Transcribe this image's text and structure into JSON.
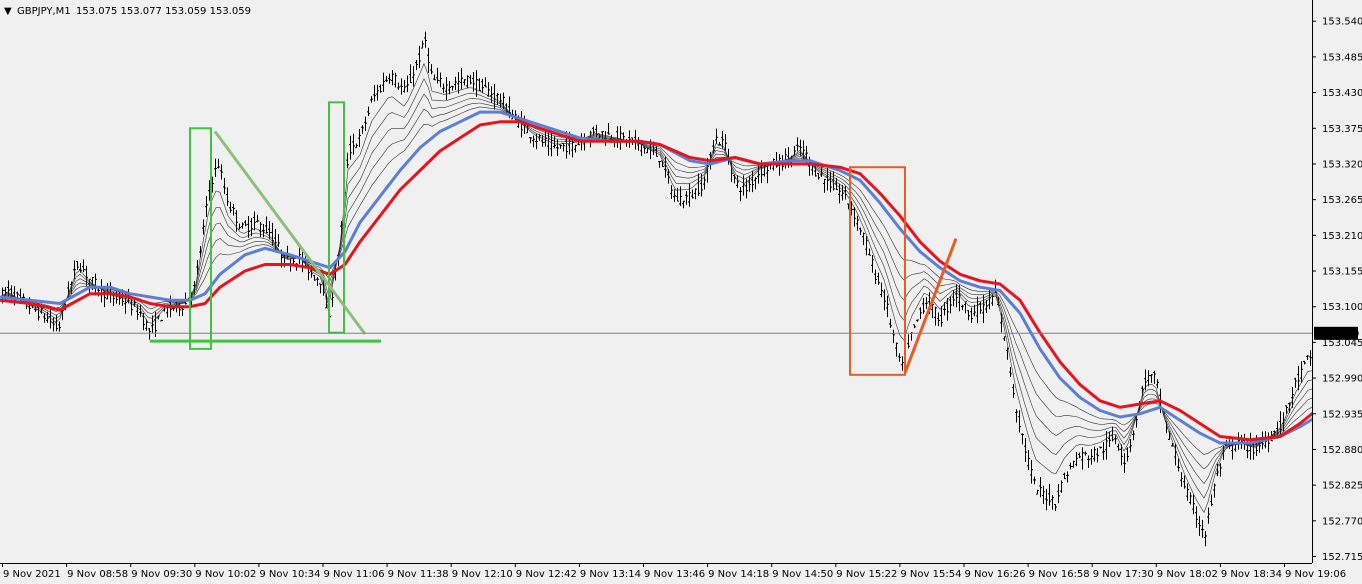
{
  "header": {
    "caret": "▼",
    "symbol": "GBPJPY,M1",
    "ohlc": "153.075 153.077 153.059 153.059"
  },
  "colors": {
    "background": "#f0f0f0",
    "candles": "#000000",
    "ema_fast": "#5b7fd6",
    "ema_slow": "#e8141c",
    "ribbon": "#303030",
    "bid_line": "#7f7f8f",
    "price_tag_bg": "#000000",
    "box_green": "#3ec43e",
    "box_orange": "#ee5a24",
    "trend_green": "#8cbf7a"
  },
  "chart_data": {
    "type": "candlestick",
    "symbol": "GBPJPY",
    "timeframe": "M1",
    "ylim": [
      152.705,
      153.565
    ],
    "current_price": 153.059,
    "current_price_label": "153.059",
    "y_ticks": [
      "153.540",
      "153.485",
      "153.430",
      "153.375",
      "153.320",
      "153.265",
      "153.210",
      "153.155",
      "153.100",
      "153.045",
      "152.990",
      "152.935",
      "152.880",
      "152.825",
      "152.770",
      "152.715"
    ],
    "x_ticks": [
      "9 Nov 2021",
      "9 Nov 08:58",
      "9 Nov 09:30",
      "9 Nov 10:02",
      "9 Nov 10:34",
      "9 Nov 11:06",
      "9 Nov 11:38",
      "9 Nov 12:10",
      "9 Nov 12:42",
      "9 Nov 13:14",
      "9 Nov 13:46",
      "9 Nov 14:18",
      "9 Nov 14:50",
      "9 Nov 15:22",
      "9 Nov 15:54",
      "9 Nov 16:26",
      "9 Nov 16:58",
      "9 Nov 17:30",
      "9 Nov 18:02",
      "9 Nov 18:34",
      "9 Nov 19:06"
    ],
    "candle_path": [
      [
        0,
        153.115
      ],
      [
        8,
        153.125
      ],
      [
        20,
        153.11
      ],
      [
        30,
        153.1
      ],
      [
        45,
        153.085
      ],
      [
        58,
        153.065
      ],
      [
        68,
        153.12
      ],
      [
        78,
        153.17
      ],
      [
        90,
        153.14
      ],
      [
        110,
        153.115
      ],
      [
        125,
        153.11
      ],
      [
        140,
        153.09
      ],
      [
        150,
        153.06
      ],
      [
        165,
        153.095
      ],
      [
        185,
        153.105
      ],
      [
        195,
        153.13
      ],
      [
        202,
        153.21
      ],
      [
        210,
        153.29
      ],
      [
        218,
        153.32
      ],
      [
        228,
        153.26
      ],
      [
        242,
        153.22
      ],
      [
        255,
        153.23
      ],
      [
        270,
        153.215
      ],
      [
        285,
        153.17
      ],
      [
        300,
        153.175
      ],
      [
        312,
        153.15
      ],
      [
        322,
        153.14
      ],
      [
        328,
        153.08
      ],
      [
        332,
        153.12
      ],
      [
        340,
        153.2
      ],
      [
        348,
        153.34
      ],
      [
        360,
        153.36
      ],
      [
        372,
        153.42
      ],
      [
        390,
        153.46
      ],
      [
        405,
        153.43
      ],
      [
        418,
        153.48
      ],
      [
        425,
        153.51
      ],
      [
        432,
        153.45
      ],
      [
        445,
        153.44
      ],
      [
        458,
        153.445
      ],
      [
        470,
        153.45
      ],
      [
        480,
        153.44
      ],
      [
        490,
        153.43
      ],
      [
        500,
        153.42
      ],
      [
        515,
        153.39
      ],
      [
        535,
        153.36
      ],
      [
        555,
        153.345
      ],
      [
        575,
        153.35
      ],
      [
        595,
        153.37
      ],
      [
        620,
        153.36
      ],
      [
        640,
        153.35
      ],
      [
        660,
        153.33
      ],
      [
        675,
        153.265
      ],
      [
        690,
        153.27
      ],
      [
        705,
        153.295
      ],
      [
        715,
        153.36
      ],
      [
        725,
        153.35
      ],
      [
        735,
        153.29
      ],
      [
        745,
        153.28
      ],
      [
        760,
        153.31
      ],
      [
        775,
        153.32
      ],
      [
        790,
        153.33
      ],
      [
        800,
        153.345
      ],
      [
        815,
        153.31
      ],
      [
        830,
        153.29
      ],
      [
        845,
        153.27
      ],
      [
        855,
        153.24
      ],
      [
        865,
        153.2
      ],
      [
        875,
        153.15
      ],
      [
        885,
        153.11
      ],
      [
        895,
        153.04
      ],
      [
        903,
        153.0
      ],
      [
        910,
        153.05
      ],
      [
        925,
        153.11
      ],
      [
        940,
        153.08
      ],
      [
        955,
        153.12
      ],
      [
        970,
        153.09
      ],
      [
        985,
        153.1
      ],
      [
        995,
        153.12
      ],
      [
        1005,
        153.05
      ],
      [
        1015,
        152.95
      ],
      [
        1025,
        152.88
      ],
      [
        1035,
        152.82
      ],
      [
        1045,
        152.81
      ],
      [
        1055,
        152.8
      ],
      [
        1065,
        152.84
      ],
      [
        1078,
        152.87
      ],
      [
        1090,
        152.87
      ],
      [
        1102,
        152.88
      ],
      [
        1115,
        152.9
      ],
      [
        1125,
        152.86
      ],
      [
        1135,
        152.92
      ],
      [
        1145,
        152.99
      ],
      [
        1155,
        152.99
      ],
      [
        1165,
        152.92
      ],
      [
        1175,
        152.87
      ],
      [
        1185,
        152.82
      ],
      [
        1195,
        152.78
      ],
      [
        1205,
        152.75
      ],
      [
        1215,
        152.83
      ],
      [
        1225,
        152.88
      ],
      [
        1240,
        152.89
      ],
      [
        1255,
        152.88
      ],
      [
        1270,
        152.9
      ],
      [
        1282,
        152.92
      ],
      [
        1295,
        152.98
      ],
      [
        1308,
        153.02
      ]
    ],
    "ema_fast_path": [
      [
        0,
        153.115
      ],
      [
        30,
        153.11
      ],
      [
        60,
        153.105
      ],
      [
        90,
        153.13
      ],
      [
        110,
        153.13
      ],
      [
        130,
        153.12
      ],
      [
        150,
        153.115
      ],
      [
        170,
        153.11
      ],
      [
        190,
        153.11
      ],
      [
        205,
        153.12
      ],
      [
        220,
        153.15
      ],
      [
        245,
        153.18
      ],
      [
        265,
        153.19
      ],
      [
        290,
        153.18
      ],
      [
        310,
        153.17
      ],
      [
        330,
        153.16
      ],
      [
        345,
        153.185
      ],
      [
        360,
        153.23
      ],
      [
        380,
        153.27
      ],
      [
        400,
        153.31
      ],
      [
        420,
        153.345
      ],
      [
        440,
        153.37
      ],
      [
        460,
        153.385
      ],
      [
        480,
        153.4
      ],
      [
        500,
        153.4
      ],
      [
        520,
        153.39
      ],
      [
        540,
        153.38
      ],
      [
        560,
        153.37
      ],
      [
        580,
        153.36
      ],
      [
        610,
        153.355
      ],
      [
        640,
        153.355
      ],
      [
        660,
        153.35
      ],
      [
        690,
        153.325
      ],
      [
        710,
        153.32
      ],
      [
        735,
        153.33
      ],
      [
        760,
        153.32
      ],
      [
        790,
        153.325
      ],
      [
        810,
        153.325
      ],
      [
        840,
        153.31
      ],
      [
        860,
        153.295
      ],
      [
        880,
        153.26
      ],
      [
        900,
        153.22
      ],
      [
        920,
        153.185
      ],
      [
        940,
        153.16
      ],
      [
        960,
        153.14
      ],
      [
        980,
        153.13
      ],
      [
        1000,
        153.125
      ],
      [
        1020,
        153.09
      ],
      [
        1040,
        153.035
      ],
      [
        1060,
        152.99
      ],
      [
        1080,
        152.96
      ],
      [
        1100,
        152.94
      ],
      [
        1120,
        152.93
      ],
      [
        1140,
        152.935
      ],
      [
        1160,
        152.945
      ],
      [
        1180,
        152.925
      ],
      [
        1200,
        152.905
      ],
      [
        1220,
        152.89
      ],
      [
        1250,
        152.89
      ],
      [
        1280,
        152.9
      ],
      [
        1300,
        152.915
      ],
      [
        1316,
        152.93
      ]
    ],
    "ema_slow_path": [
      [
        0,
        153.11
      ],
      [
        30,
        153.105
      ],
      [
        60,
        153.095
      ],
      [
        90,
        153.12
      ],
      [
        110,
        153.12
      ],
      [
        130,
        153.115
      ],
      [
        150,
        153.105
      ],
      [
        170,
        153.1
      ],
      [
        190,
        153.1
      ],
      [
        205,
        153.105
      ],
      [
        220,
        153.13
      ],
      [
        245,
        153.155
      ],
      [
        265,
        153.165
      ],
      [
        290,
        153.165
      ],
      [
        310,
        153.16
      ],
      [
        330,
        153.15
      ],
      [
        345,
        153.165
      ],
      [
        360,
        153.2
      ],
      [
        380,
        153.24
      ],
      [
        400,
        153.28
      ],
      [
        420,
        153.31
      ],
      [
        440,
        153.34
      ],
      [
        460,
        153.36
      ],
      [
        480,
        153.38
      ],
      [
        500,
        153.385
      ],
      [
        520,
        153.385
      ],
      [
        540,
        153.375
      ],
      [
        560,
        153.365
      ],
      [
        580,
        153.355
      ],
      [
        610,
        153.355
      ],
      [
        640,
        153.355
      ],
      [
        660,
        153.35
      ],
      [
        690,
        153.33
      ],
      [
        710,
        153.325
      ],
      [
        735,
        153.33
      ],
      [
        760,
        153.32
      ],
      [
        790,
        153.32
      ],
      [
        810,
        153.32
      ],
      [
        840,
        153.315
      ],
      [
        860,
        153.305
      ],
      [
        880,
        153.275
      ],
      [
        900,
        153.24
      ],
      [
        920,
        153.2
      ],
      [
        940,
        153.17
      ],
      [
        960,
        153.15
      ],
      [
        980,
        153.14
      ],
      [
        1000,
        153.135
      ],
      [
        1020,
        153.11
      ],
      [
        1040,
        153.06
      ],
      [
        1060,
        153.015
      ],
      [
        1080,
        152.98
      ],
      [
        1100,
        152.955
      ],
      [
        1120,
        152.945
      ],
      [
        1140,
        152.95
      ],
      [
        1160,
        152.955
      ],
      [
        1180,
        152.94
      ],
      [
        1200,
        152.92
      ],
      [
        1220,
        152.9
      ],
      [
        1250,
        152.895
      ],
      [
        1280,
        152.9
      ],
      [
        1300,
        152.92
      ],
      [
        1316,
        152.94
      ]
    ],
    "annotations": [
      {
        "type": "rect",
        "color": "green",
        "t0": 190,
        "t1": 211,
        "p_top": 153.375,
        "p_bottom": 153.035
      },
      {
        "type": "rect",
        "color": "green",
        "t0": 329,
        "t1": 344,
        "p_top": 153.415,
        "p_bottom": 153.06
      },
      {
        "type": "hline",
        "color": "green",
        "t0": 150,
        "t1": 381,
        "p": 153.047
      },
      {
        "type": "trendline",
        "color": "light-green",
        "t0": 215,
        "p0": 153.37,
        "t1": 365,
        "p1": 153.058
      },
      {
        "type": "rect",
        "color": "orange",
        "t0": 850,
        "t1": 905,
        "p_top": 153.315,
        "p_bottom": 152.995
      },
      {
        "type": "trendline",
        "color": "orange",
        "t0": 905,
        "p0": 152.998,
        "t1": 956,
        "p1": 153.205
      }
    ]
  }
}
